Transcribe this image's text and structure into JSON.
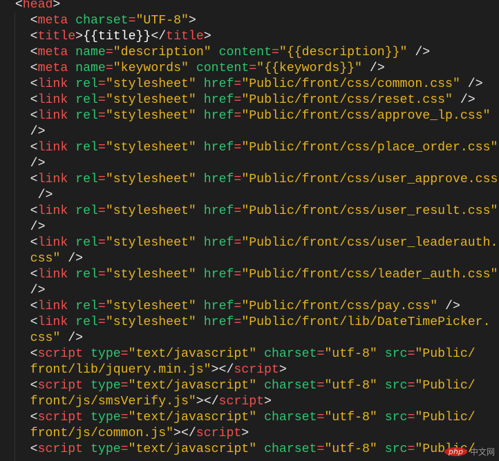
{
  "colors": {
    "background": "#1e1e1e",
    "tag": "#f0524f",
    "attribute": "#2ec66f",
    "string": "#e6b422",
    "punct": "#e8e8e8"
  },
  "watermark": {
    "logo": "php",
    "text": "中文网"
  },
  "lines": [
    [
      [
        "p",
        "  <"
      ],
      [
        "t",
        "head"
      ],
      [
        "p",
        ">"
      ]
    ],
    [
      [
        "p",
        "    <"
      ],
      [
        "t",
        "meta"
      ],
      [
        "p",
        " "
      ],
      [
        "a",
        "charset"
      ],
      [
        "e",
        "="
      ],
      [
        "s",
        "\"UTF-8\""
      ],
      [
        "p",
        ">"
      ]
    ],
    [
      [
        "p",
        "    <"
      ],
      [
        "t",
        "title"
      ],
      [
        "p",
        ">"
      ],
      [
        "x",
        "{{title}}"
      ],
      [
        "p",
        "</"
      ],
      [
        "t",
        "title"
      ],
      [
        "p",
        ">"
      ]
    ],
    [
      [
        "p",
        "    <"
      ],
      [
        "t",
        "meta"
      ],
      [
        "p",
        " "
      ],
      [
        "a",
        "name"
      ],
      [
        "e",
        "="
      ],
      [
        "s",
        "\"description\""
      ],
      [
        "p",
        " "
      ],
      [
        "a",
        "content"
      ],
      [
        "e",
        "="
      ],
      [
        "s",
        "\"{{description}}\""
      ],
      [
        "p",
        " />"
      ]
    ],
    [
      [
        "p",
        "    <"
      ],
      [
        "t",
        "meta"
      ],
      [
        "p",
        " "
      ],
      [
        "a",
        "name"
      ],
      [
        "e",
        "="
      ],
      [
        "s",
        "\"keywords\""
      ],
      [
        "p",
        " "
      ],
      [
        "a",
        "content"
      ],
      [
        "e",
        "="
      ],
      [
        "s",
        "\"{{keywords}}\""
      ],
      [
        "p",
        " />"
      ]
    ],
    [
      [
        "p",
        "    <"
      ],
      [
        "t",
        "link"
      ],
      [
        "p",
        " "
      ],
      [
        "a",
        "rel"
      ],
      [
        "e",
        "="
      ],
      [
        "s",
        "\"stylesheet\""
      ],
      [
        "p",
        " "
      ],
      [
        "a",
        "href"
      ],
      [
        "e",
        "="
      ],
      [
        "s",
        "\"Public/front/css/common.css\""
      ],
      [
        "p",
        " />"
      ]
    ],
    [
      [
        "p",
        "    <"
      ],
      [
        "t",
        "link"
      ],
      [
        "p",
        " "
      ],
      [
        "a",
        "rel"
      ],
      [
        "e",
        "="
      ],
      [
        "s",
        "\"stylesheet\""
      ],
      [
        "p",
        " "
      ],
      [
        "a",
        "href"
      ],
      [
        "e",
        "="
      ],
      [
        "s",
        "\"Public/front/css/reset.css\""
      ],
      [
        "p",
        " />"
      ]
    ],
    [
      [
        "p",
        "    <"
      ],
      [
        "t",
        "link"
      ],
      [
        "p",
        " "
      ],
      [
        "a",
        "rel"
      ],
      [
        "e",
        "="
      ],
      [
        "s",
        "\"stylesheet\""
      ],
      [
        "p",
        " "
      ],
      [
        "a",
        "href"
      ],
      [
        "e",
        "="
      ],
      [
        "s",
        "\"Public/front/css/approve_lp.css\""
      ]
    ],
    [
      [
        "p",
        "    />"
      ]
    ],
    [
      [
        "p",
        "    <"
      ],
      [
        "t",
        "link"
      ],
      [
        "p",
        " "
      ],
      [
        "a",
        "rel"
      ],
      [
        "e",
        "="
      ],
      [
        "s",
        "\"stylesheet\""
      ],
      [
        "p",
        " "
      ],
      [
        "a",
        "href"
      ],
      [
        "e",
        "="
      ],
      [
        "s",
        "\"Public/front/css/place_order.css\""
      ]
    ],
    [
      [
        "p",
        "    />"
      ]
    ],
    [
      [
        "p",
        "    <"
      ],
      [
        "t",
        "link"
      ],
      [
        "p",
        " "
      ],
      [
        "a",
        "rel"
      ],
      [
        "e",
        "="
      ],
      [
        "s",
        "\"stylesheet\""
      ],
      [
        "p",
        " "
      ],
      [
        "a",
        "href"
      ],
      [
        "e",
        "="
      ],
      [
        "s",
        "\"Public/front/css/user_approve.css\""
      ]
    ],
    [
      [
        "p",
        "     />"
      ]
    ],
    [
      [
        "p",
        "    <"
      ],
      [
        "t",
        "link"
      ],
      [
        "p",
        " "
      ],
      [
        "a",
        "rel"
      ],
      [
        "e",
        "="
      ],
      [
        "s",
        "\"stylesheet\""
      ],
      [
        "p",
        " "
      ],
      [
        "a",
        "href"
      ],
      [
        "e",
        "="
      ],
      [
        "s",
        "\"Public/front/css/user_result.css\""
      ]
    ],
    [
      [
        "p",
        "    />"
      ]
    ],
    [
      [
        "p",
        "    <"
      ],
      [
        "t",
        "link"
      ],
      [
        "p",
        " "
      ],
      [
        "a",
        "rel"
      ],
      [
        "e",
        "="
      ],
      [
        "s",
        "\"stylesheet\""
      ],
      [
        "p",
        " "
      ],
      [
        "a",
        "href"
      ],
      [
        "e",
        "="
      ],
      [
        "s",
        "\"Public/front/css/user_leaderauth."
      ]
    ],
    [
      [
        "s",
        "    css\""
      ],
      [
        "p",
        " />"
      ]
    ],
    [
      [
        "p",
        "    <"
      ],
      [
        "t",
        "link"
      ],
      [
        "p",
        " "
      ],
      [
        "a",
        "rel"
      ],
      [
        "e",
        "="
      ],
      [
        "s",
        "\"stylesheet\""
      ],
      [
        "p",
        " "
      ],
      [
        "a",
        "href"
      ],
      [
        "e",
        "="
      ],
      [
        "s",
        "\"Public/front/css/leader_auth.css\""
      ]
    ],
    [
      [
        "p",
        "    />"
      ]
    ],
    [
      [
        "p",
        "    <"
      ],
      [
        "t",
        "link"
      ],
      [
        "p",
        " "
      ],
      [
        "a",
        "rel"
      ],
      [
        "e",
        "="
      ],
      [
        "s",
        "\"stylesheet\""
      ],
      [
        "p",
        " "
      ],
      [
        "a",
        "href"
      ],
      [
        "e",
        "="
      ],
      [
        "s",
        "\"Public/front/css/pay.css\""
      ],
      [
        "p",
        " />"
      ]
    ],
    [
      [
        "p",
        "    <"
      ],
      [
        "t",
        "link"
      ],
      [
        "p",
        " "
      ],
      [
        "a",
        "rel"
      ],
      [
        "e",
        "="
      ],
      [
        "s",
        "\"stylesheet\""
      ],
      [
        "p",
        " "
      ],
      [
        "a",
        "href"
      ],
      [
        "e",
        "="
      ],
      [
        "s",
        "\"Public/front/lib/DateTimePicker."
      ]
    ],
    [
      [
        "s",
        "    css\""
      ],
      [
        "p",
        " />"
      ]
    ],
    [
      [
        "p",
        "    <"
      ],
      [
        "t",
        "script"
      ],
      [
        "p",
        " "
      ],
      [
        "a",
        "type"
      ],
      [
        "e",
        "="
      ],
      [
        "s",
        "\"text/javascript\""
      ],
      [
        "p",
        " "
      ],
      [
        "a",
        "charset"
      ],
      [
        "e",
        "="
      ],
      [
        "s",
        "\"utf-8\""
      ],
      [
        "p",
        " "
      ],
      [
        "a",
        "src"
      ],
      [
        "e",
        "="
      ],
      [
        "s",
        "\"Public/"
      ]
    ],
    [
      [
        "s",
        "    front/lib/jquery.min.js\""
      ],
      [
        "p",
        "></"
      ],
      [
        "t",
        "script"
      ],
      [
        "p",
        ">"
      ]
    ],
    [
      [
        "p",
        "    <"
      ],
      [
        "t",
        "script"
      ],
      [
        "p",
        " "
      ],
      [
        "a",
        "type"
      ],
      [
        "e",
        "="
      ],
      [
        "s",
        "\"text/javascript\""
      ],
      [
        "p",
        " "
      ],
      [
        "a",
        "charset"
      ],
      [
        "e",
        "="
      ],
      [
        "s",
        "\"utf-8\""
      ],
      [
        "p",
        " "
      ],
      [
        "a",
        "src"
      ],
      [
        "e",
        "="
      ],
      [
        "s",
        "\"Public/"
      ]
    ],
    [
      [
        "s",
        "    front/js/smsVerify.js\""
      ],
      [
        "p",
        "></"
      ],
      [
        "t",
        "script"
      ],
      [
        "p",
        ">"
      ]
    ],
    [
      [
        "p",
        "    <"
      ],
      [
        "t",
        "script"
      ],
      [
        "p",
        " "
      ],
      [
        "a",
        "type"
      ],
      [
        "e",
        "="
      ],
      [
        "s",
        "\"text/javascript\""
      ],
      [
        "p",
        " "
      ],
      [
        "a",
        "charset"
      ],
      [
        "e",
        "="
      ],
      [
        "s",
        "\"utf-8\""
      ],
      [
        "p",
        " "
      ],
      [
        "a",
        "src"
      ],
      [
        "e",
        "="
      ],
      [
        "s",
        "\"Public/"
      ]
    ],
    [
      [
        "s",
        "    front/js/common.js\""
      ],
      [
        "p",
        "></"
      ],
      [
        "t",
        "script"
      ],
      [
        "p",
        ">"
      ]
    ],
    [
      [
        "p",
        "    <"
      ],
      [
        "t",
        "script"
      ],
      [
        "p",
        " "
      ],
      [
        "a",
        "type"
      ],
      [
        "e",
        "="
      ],
      [
        "s",
        "\"text/javascript\""
      ],
      [
        "p",
        " "
      ],
      [
        "a",
        "charset"
      ],
      [
        "e",
        "="
      ],
      [
        "s",
        "\"utf-8\""
      ],
      [
        "p",
        " "
      ],
      [
        "a",
        "src"
      ],
      [
        "e",
        "="
      ],
      [
        "s",
        "\"Public/"
      ]
    ]
  ]
}
